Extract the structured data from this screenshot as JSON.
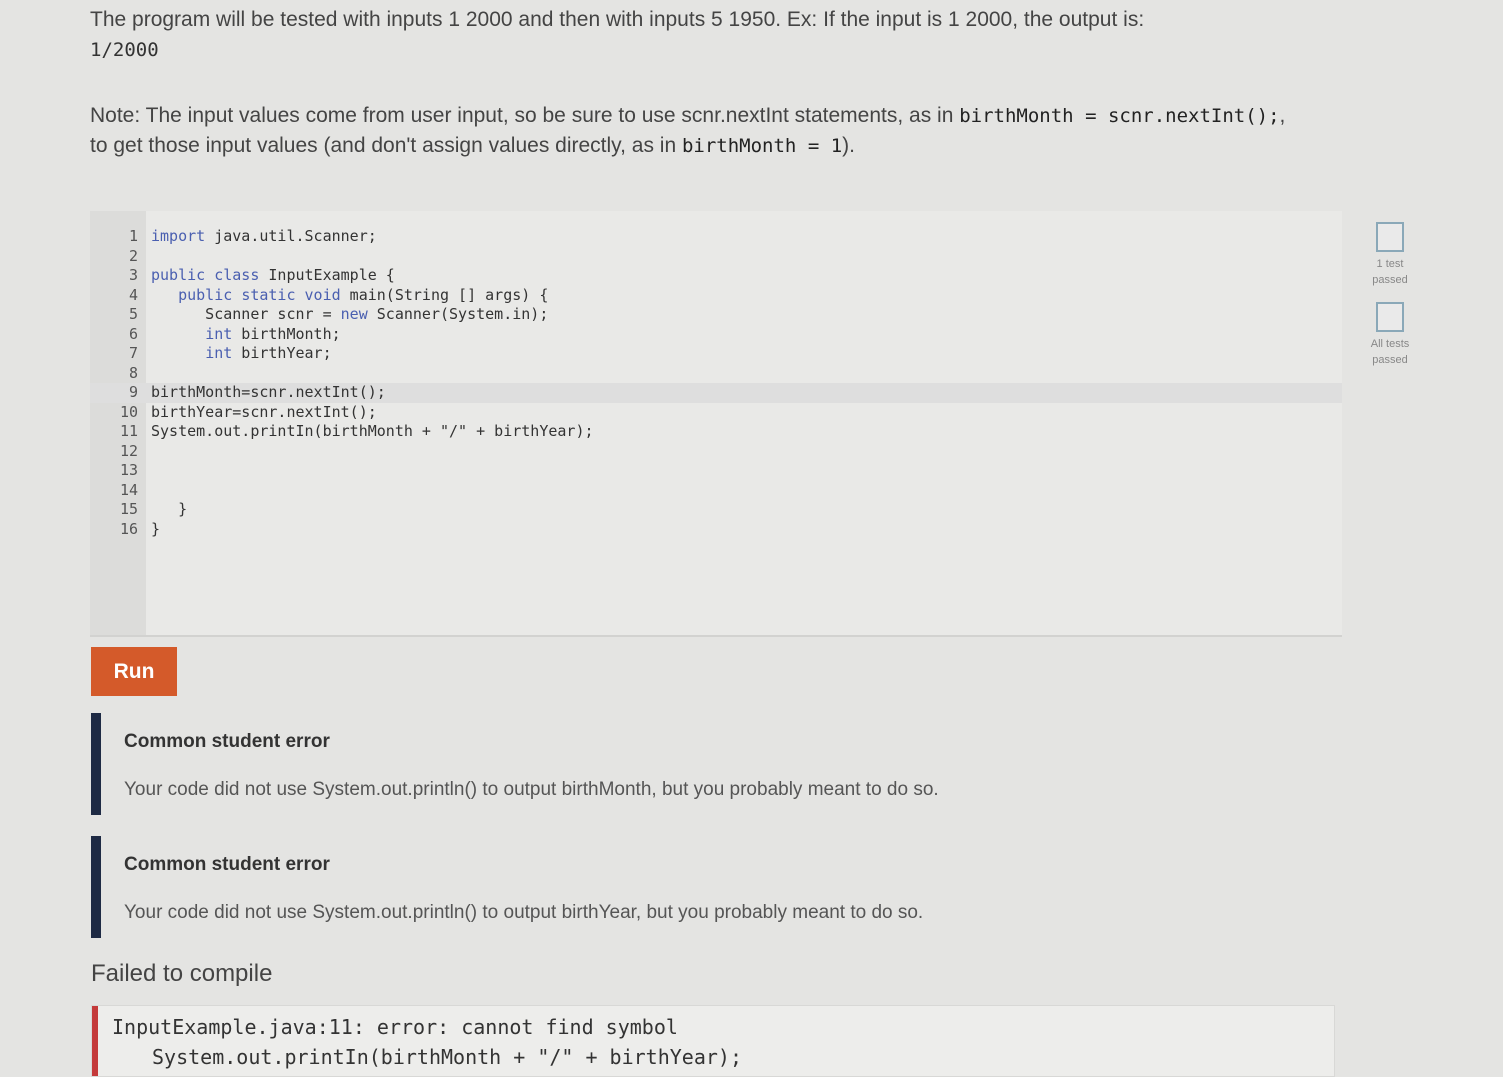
{
  "instructions": {
    "line1": "The program will be tested with inputs 1 2000 and then with inputs 5 1950. Ex: If the input is 1 2000, the output is:",
    "example_output": "1/2000",
    "note_prefix": "Note: The input values come from user input, so be sure to use scnr.nextInt statements, as in",
    "note_code1": "birthMonth = scnr.nextInt();",
    "note_mid": ",",
    "note_line2_prefix": "to get those input values (and don't assign values directly, as in",
    "note_code2": "birthMonth = 1",
    "note_suffix": ")."
  },
  "editor": {
    "lines": [
      {
        "num": "1",
        "code": "import java.util.Scanner;"
      },
      {
        "num": "2",
        "code": ""
      },
      {
        "num": "3",
        "code": "public class InputExample {"
      },
      {
        "num": "4",
        "code": "   public static void main(String [] args) {"
      },
      {
        "num": "5",
        "code": "      Scanner scnr = new Scanner(System.in);"
      },
      {
        "num": "6",
        "code": "      int birthMonth;"
      },
      {
        "num": "7",
        "code": "      int birthYear;"
      },
      {
        "num": "8",
        "code": ""
      },
      {
        "num": "9",
        "code": "birthMonth=scnr.nextInt();"
      },
      {
        "num": "10",
        "code": "birthYear=scnr.nextInt();"
      },
      {
        "num": "11",
        "code": "System.out.printIn(birthMonth + \"/\" + birthYear);"
      },
      {
        "num": "12",
        "code": ""
      },
      {
        "num": "13",
        "code": ""
      },
      {
        "num": "14",
        "code": ""
      },
      {
        "num": "15",
        "code": "   }"
      },
      {
        "num": "16",
        "code": "}"
      }
    ]
  },
  "run_label": "Run",
  "errors": [
    {
      "title": "Common student error",
      "message": "Your code did not use System.out.println() to output birthMonth, but you probably meant to do so."
    },
    {
      "title": "Common student error",
      "message": "Your code did not use System.out.println() to output birthYear, but you probably meant to do so."
    }
  ],
  "compile": {
    "title": "Failed to compile",
    "line1": "InputExample.java:11: error: cannot find symbol",
    "line2": "System.out.printIn(birthMonth + \"/\" + birthYear);"
  },
  "status": [
    {
      "label_1": "1 test",
      "label_2": "passed"
    },
    {
      "label_1": "All tests",
      "label_2": "passed"
    }
  ],
  "colors": {
    "run_button": "#d45a2a",
    "error_bar": "#1e2a44",
    "compile_bar": "#c43a3a",
    "status_box_border": "#8aa8b8"
  }
}
